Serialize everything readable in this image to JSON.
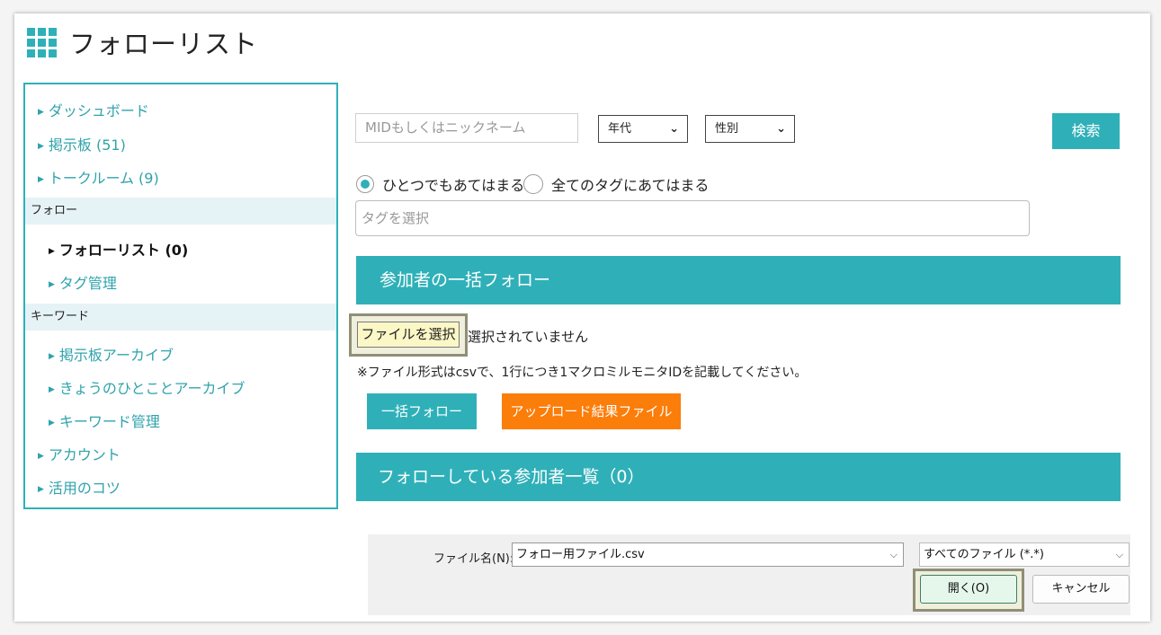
{
  "page": {
    "title": "フォローリスト",
    "title_icon": "grid-icon"
  },
  "sidebar": {
    "items": [
      {
        "label": "ダッシュボード"
      },
      {
        "label": "掲示板 (51)"
      },
      {
        "label": "トークルーム (9)"
      },
      {
        "label": "フォローリスト (0)",
        "active": true
      },
      {
        "label": "タグ管理"
      },
      {
        "label": "掲示板アーカイブ"
      },
      {
        "label": "きょうのひとことアーカイブ"
      },
      {
        "label": "キーワード管理"
      },
      {
        "label": "アカウント"
      },
      {
        "label": "活用のコツ"
      }
    ],
    "sections": [
      "フォロー",
      "キーワード"
    ],
    "bullet": "▶"
  },
  "search": {
    "mid_placeholder": "MIDもしくはニックネーム",
    "age_select": "年代",
    "gender_select": "性別",
    "search_button": "検索",
    "chevron": "⌄"
  },
  "tags": {
    "radio_any": "ひとつでもあてはまる",
    "radio_all": "全てのタグにあてはまる",
    "selected_radio": "any",
    "tag_placeholder": "タグを選択"
  },
  "bulk": {
    "heading": "参加者の一括フォロー",
    "file_button": "ファイルを選択",
    "file_status": "選択されていません",
    "note": "※ファイル形式はcsvで、1行につき1マクロミルモニタIDを記載してください。",
    "bulk_follow_button": "一括フォロー",
    "upload_result_button": "アップロード結果ファイル"
  },
  "following": {
    "heading": "フォローしている参加者一覧（0）"
  },
  "file_dialog": {
    "filename_label": "ファイル名(N):",
    "filename_value": "フォロー用ファイル.csv",
    "filetype_value": "すべてのファイル (*.*)",
    "open_button": "開く(O)",
    "cancel_button": "キャンセル",
    "chevron": "⌵"
  },
  "colors": {
    "accent": "#2fb0b8",
    "orange": "#fb7d0a",
    "highlight_border": "#8f8f77"
  }
}
